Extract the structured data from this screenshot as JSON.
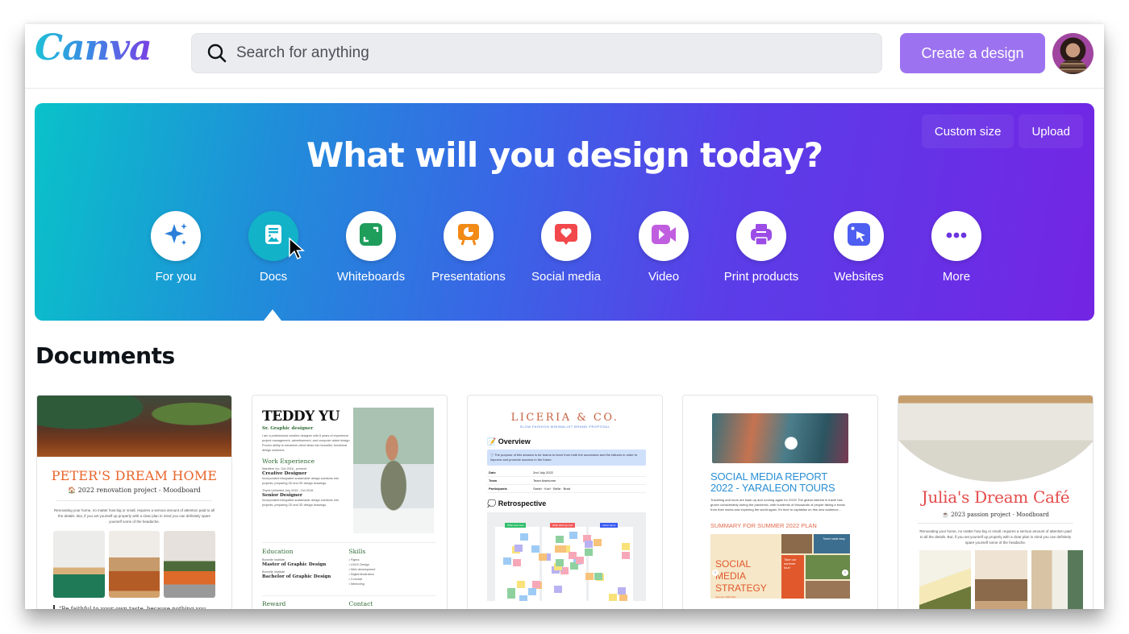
{
  "app": {
    "logo": "Canva"
  },
  "header": {
    "search_placeholder": "Search for anything",
    "create_button": "Create a design",
    "avatar_alt": "User profile"
  },
  "hero": {
    "title": "What will you design today?",
    "actions": [
      "Custom size",
      "Upload"
    ],
    "categories": [
      {
        "label": "For you",
        "icon": "sparkle-icon",
        "color": "#2b7fd9",
        "active": false
      },
      {
        "label": "Docs",
        "icon": "doc-icon",
        "color": "#12b2c9",
        "active": true
      },
      {
        "label": "Whiteboards",
        "icon": "whiteboard-icon",
        "color": "#1f9d5b",
        "active": false
      },
      {
        "label": "Presentations",
        "icon": "presentation-icon",
        "color": "#f28a16",
        "active": false
      },
      {
        "label": "Social media",
        "icon": "heart-icon",
        "color": "#f2474b",
        "active": false
      },
      {
        "label": "Video",
        "icon": "video-icon",
        "color": "#c05ee0",
        "active": false
      },
      {
        "label": "Print products",
        "icon": "printer-icon",
        "color": "#9b4ce6",
        "active": false
      },
      {
        "label": "Websites",
        "icon": "cursor-icon",
        "color": "#4d5ef0",
        "active": false
      },
      {
        "label": "More",
        "icon": "more-icon",
        "color": "#6b35e0",
        "active": false
      }
    ]
  },
  "documents": {
    "section_title": "Documents",
    "cards": [
      {
        "title": "PETER'S DREAM HOME",
        "subtitle": "🏠 2022 renovation project - Moodboard",
        "body": "Renovating your home, no matter how big or small, requires a serious amount of attention paid to all the details. But, if you set yourself up properly with a clear plan in mind you can definitely spare yourself some of the headache.",
        "quote": "\"Be faithful to your own taste, because nothing you really like is ever out of style.\""
      },
      {
        "name": "TEDDY YU",
        "role": "Sr. Graphic designer",
        "intro": "I am a professional creative designer with 8 years of experience project management, advertisement, and computer aided design. Proven ability to transform client ideas into beautiful, functional design solutions.",
        "work_heading": "Work Experience",
        "jobs": [
          {
            "meta": "Wardiere Inc. Oct 2016 - present",
            "title": "Creative Designer",
            "desc": "Incorporated integrated sustainable design solutions into projects, preparing 2D and 3D design drawings."
          },
          {
            "meta": "Thynk Unlimited July 2015 - Oct 2016",
            "title": "Senior Designer",
            "desc": "Incorporated integrated sustainable design solutions into projects, preparing 2D and 3D design drawings."
          }
        ],
        "education_heading": "Education",
        "education": [
          {
            "school": "Borcelle Institute",
            "degree": "Master of Graphic Design"
          },
          {
            "school": "Borcelle Institute",
            "degree": "Bachelor of Graphic Design"
          }
        ],
        "skills_heading": "Skills",
        "skills": [
          "Figma",
          "UI/UX Design",
          "Web development",
          "Digital Illustration",
          "Concept",
          "Mentoring"
        ],
        "reward_heading": "Reward",
        "contact_heading": "Contact"
      },
      {
        "brand": "LICERIA & CO.",
        "tagline": "SLOW FASHION MINIMALIST BRAND PROPOSAL",
        "overview_heading": "📝 Overview",
        "note": "ⓘ The purpose of this session is for teams to learn from both the successes and the failures in order to improve and promote success in the future.",
        "table": [
          {
            "key": "Date",
            "value": "2nd July 2022"
          },
          {
            "key": "Team",
            "value": "Team Awesome"
          },
          {
            "key": "Participants",
            "value": "Sarah · Kurt · Bella · Brad"
          }
        ],
        "retro_heading": "💭 Retrospective",
        "board_labels": [
          "What went well",
          "What didn't go well",
          "Action items"
        ]
      },
      {
        "title": "SOCIAL MEDIA REPORT 2022 - YARALEON TOURS",
        "body": "Travelling and tours are back up and running again for 2022! The global interest in travel has grown considerably during the pandemic, with hundreds of thousands of people taking a break from their works and exploring the world again. It's time to capitalise on this new audience...",
        "summary_heading": "SUMMARY FOR SUMMER 2022 PLAN",
        "slide_title": "SOCIAL MEDIA STRATEGY",
        "slide_sub": "Summer 2022 Plan",
        "slide_tile_1": "Take our summer tour!",
        "slide_tile_2": "Travel made easy"
      },
      {
        "title": "Julia's Dream Café",
        "subtitle": "☕ 2023 passion project - Moodboard",
        "body": "Renovating your home, no matter how big or small, requires a serious amount of attention paid to all the details. But, if you set yourself up properly with a clear plan in mind you can definitely spare yourself some of the headache."
      }
    ]
  }
}
